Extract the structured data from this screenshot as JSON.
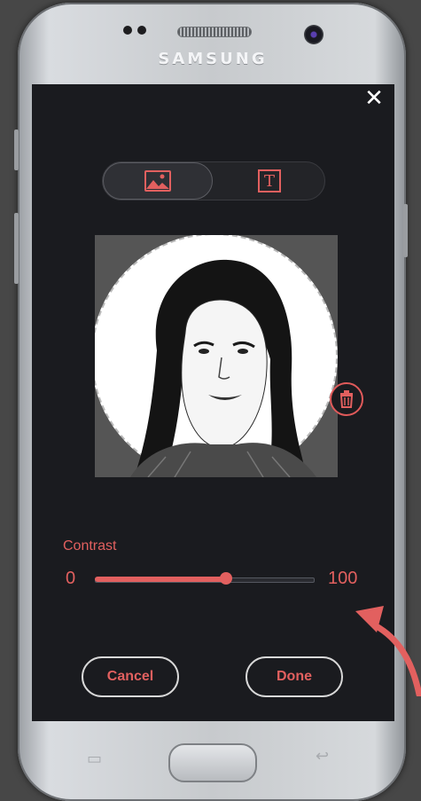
{
  "device": {
    "brand": "SAMSUNG"
  },
  "toggle": {
    "image_tab_icon": "image-icon",
    "text_tab_icon": "text-icon",
    "text_tab_glyph": "T"
  },
  "editor": {
    "close_icon": "close-icon",
    "delete_icon": "trash-icon"
  },
  "contrast": {
    "label": "Contrast",
    "min": "0",
    "max": "100",
    "value": 60
  },
  "actions": {
    "cancel_label": "Cancel",
    "done_label": "Done"
  },
  "colors": {
    "accent": "#e2605f",
    "screen_bg": "#1a1b1f"
  }
}
